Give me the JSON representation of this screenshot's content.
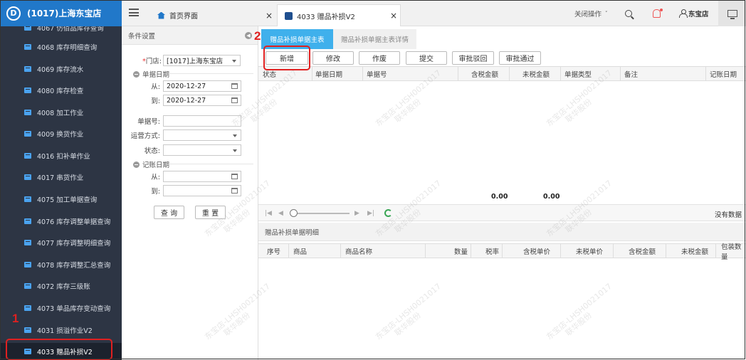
{
  "app": {
    "store_title": "(1017)上海东宝店",
    "logo_letter": "D"
  },
  "sidebar": {
    "items": [
      {
        "label": "4067 仿佰品库存查询"
      },
      {
        "label": "4068 库存明细查询"
      },
      {
        "label": "4069 库存流水"
      },
      {
        "label": "4080 库存检查"
      },
      {
        "label": "4008 加工作业"
      },
      {
        "label": "4009 换货作业"
      },
      {
        "label": "4016 扣补单作业"
      },
      {
        "label": "4017 串货作业"
      },
      {
        "label": "4075 加工单据查询"
      },
      {
        "label": "4076 库存调整单据查询"
      },
      {
        "label": "4077 库存调整明细查询"
      },
      {
        "label": "4078 库存调整汇总查询"
      },
      {
        "label": "4072 库存三级账"
      },
      {
        "label": "4073 单品库存变动查询"
      },
      {
        "label": "4031 损溢作业V2"
      },
      {
        "label": "4033 赠品补损V2",
        "active": true
      }
    ]
  },
  "topbar": {
    "home_tab": "首页界面",
    "active_tab": "4033 赠品补损V2",
    "close_glyph": "×",
    "close_ops": "关闭操作",
    "user": "东宝店"
  },
  "conditions": {
    "title": "条件设置",
    "store_label": "门店:",
    "store_value": "[1017]上海东宝店",
    "doc_date_section": "单据日期",
    "from_label": "从:",
    "to_label": "到:",
    "from_date": "2020-12-27",
    "to_date": "2020-12-27",
    "doc_no_label": "单据号:",
    "shipping_label": "运营方式:",
    "status_label": "状态:",
    "post_date_section": "记账日期",
    "post_from_label": "从:",
    "post_to_label": "到:",
    "query_btn": "查 询",
    "reset_btn": "重 置"
  },
  "main": {
    "subtabs": [
      "赠品补损单据主表",
      "赠品补损单据主表详情"
    ],
    "toolbar": [
      "新增",
      "修改",
      "作废",
      "提交",
      "审批驳回",
      "审批通过"
    ],
    "master_columns": [
      "状态",
      "单据日期",
      "单据号",
      "含税金额",
      "未税金额",
      "单据类型",
      "备注",
      "记账日期"
    ],
    "totals": {
      "tax_incl": "0.00",
      "tax_excl": "0.00"
    },
    "no_data": "没有数据",
    "detail_title": "赠品补损单据明细",
    "detail_columns": [
      "序号",
      "商品",
      "商品名称",
      "数量",
      "税率",
      "含税单价",
      "未税单价",
      "含税金额",
      "未税金额",
      "包装数量"
    ]
  },
  "watermark": {
    "line1": "东宝店-LHSH0021017",
    "line2": "联华股份"
  },
  "annotations": {
    "step1": "1",
    "step2": "2"
  }
}
